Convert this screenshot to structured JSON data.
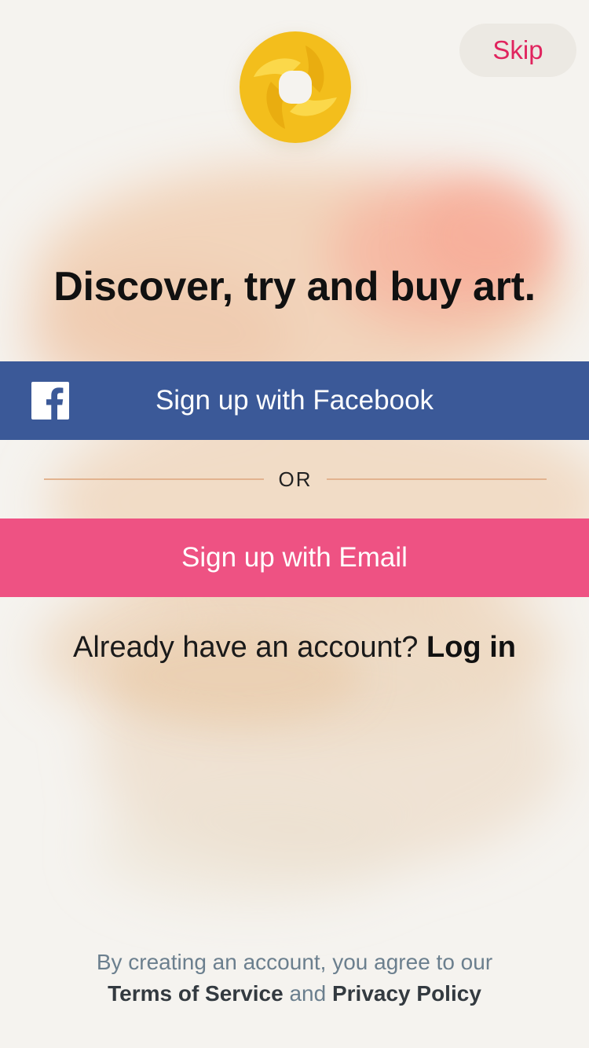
{
  "header": {
    "skip_label": "Skip"
  },
  "hero": {
    "headline": "Discover, try and buy art."
  },
  "buttons": {
    "facebook_label": "Sign up with Facebook",
    "email_label": "Sign up with Email"
  },
  "divider": {
    "or_text": "OR"
  },
  "login": {
    "prompt": "Already have an account?",
    "link_label": "Log in"
  },
  "legal": {
    "prefix": "By creating an account, you agree to our",
    "terms_label": "Terms of Service",
    "and": "and",
    "privacy_label": "Privacy Policy"
  },
  "icons": {
    "app_logo": "app-logo-icon",
    "facebook": "facebook-icon"
  },
  "colors": {
    "background": "#f5f3ef",
    "facebook_blue": "#3b5998",
    "email_pink": "#ee5283",
    "skip_text": "#e0245e",
    "logo_gold": "#f3be1c"
  }
}
